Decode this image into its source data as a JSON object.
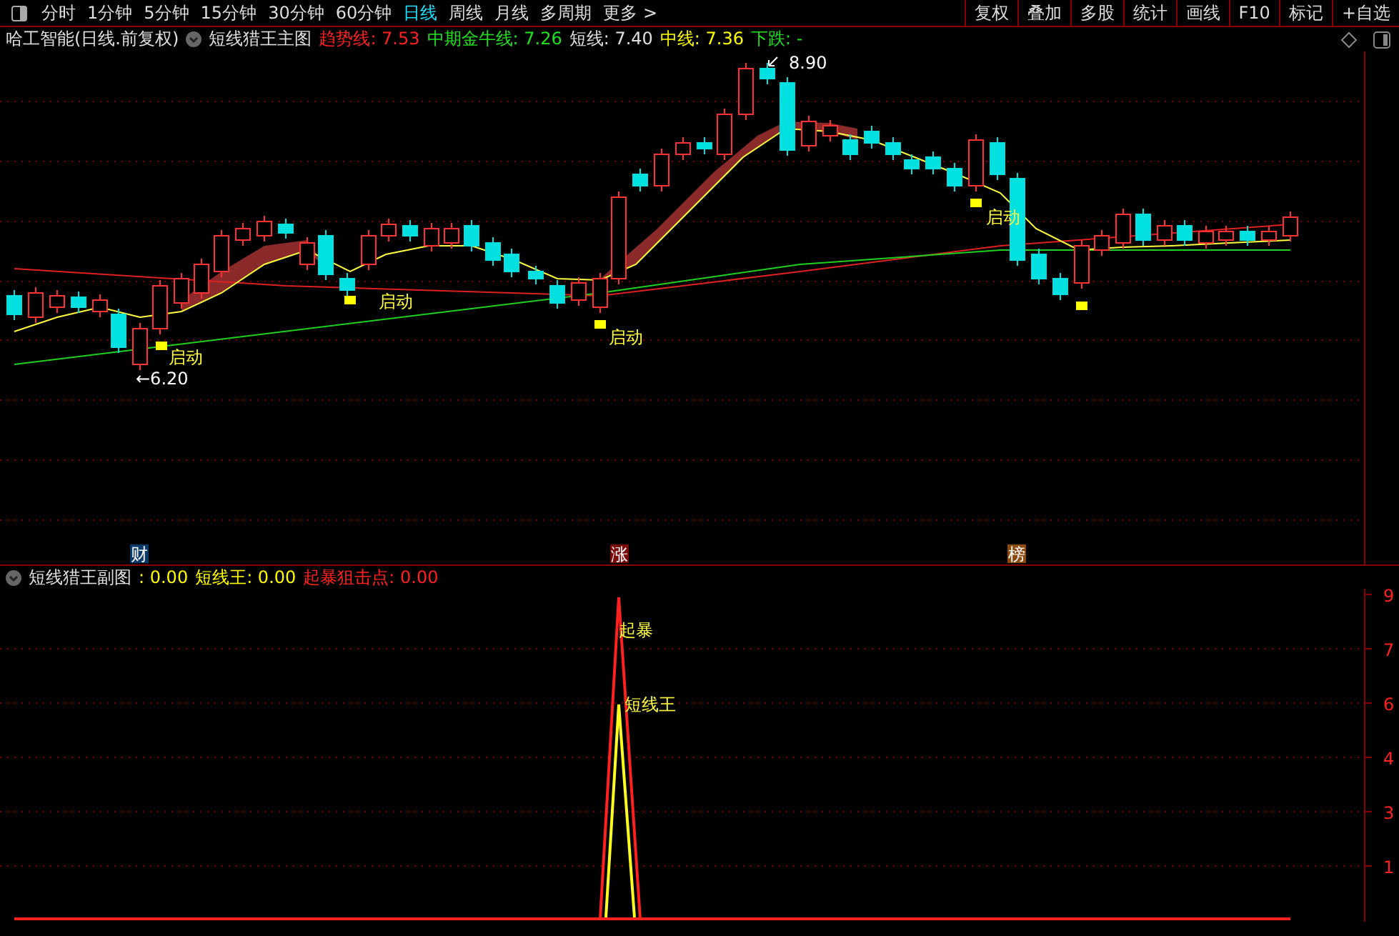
{
  "toolbar": {
    "tabs": [
      {
        "label": "分时",
        "selected": false
      },
      {
        "label": "1分钟",
        "selected": false
      },
      {
        "label": "5分钟",
        "selected": false
      },
      {
        "label": "15分钟",
        "selected": false
      },
      {
        "label": "30分钟",
        "selected": false
      },
      {
        "label": "60分钟",
        "selected": false
      },
      {
        "label": "日线",
        "selected": true
      },
      {
        "label": "周线",
        "selected": false
      },
      {
        "label": "月线",
        "selected": false
      },
      {
        "label": "多周期",
        "selected": false
      },
      {
        "label": "更多 >",
        "selected": false
      }
    ],
    "buttons": [
      "复权",
      "叠加",
      "多股",
      "统计",
      "画线",
      "F10",
      "标记",
      "+自选"
    ]
  },
  "main_chart": {
    "stock": "哈工智能(日线.前复权)",
    "indicator": "短线猎王主图",
    "readings": [
      {
        "text": "趋势线: 7.53",
        "color": "#ff2020"
      },
      {
        "text": "中期金牛线: 7.26",
        "color": "#20e020"
      },
      {
        "text": "短线: 7.40",
        "color": "#e0e0e0"
      },
      {
        "text": "中线: 7.36",
        "color": "#ffff00"
      },
      {
        "text": "下跌: -",
        "color": "#20e020"
      }
    ],
    "high_label": "8.90",
    "low_label": "←6.20",
    "signals": [
      "启动",
      "启动",
      "启动",
      "启动"
    ],
    "events": [
      {
        "text": "财",
        "color": "#0a3a6a"
      },
      {
        "text": "涨",
        "color": "#7a0a0a"
      },
      {
        "text": "榜",
        "color": "#8a4a10"
      }
    ]
  },
  "sub_chart": {
    "indicator": "短线猎王副图",
    "readings": [
      {
        "text": ": 0.00",
        "color": "#ffff00"
      },
      {
        "text": "短线王: 0.00",
        "color": "#ffff00"
      },
      {
        "text": "起暴狙击点: 0.00",
        "color": "#ff2020"
      }
    ],
    "labels": [
      "起暴",
      "短线王"
    ],
    "axis_labels": [
      "9",
      "7",
      "6",
      "4",
      "3",
      "1"
    ]
  }
}
